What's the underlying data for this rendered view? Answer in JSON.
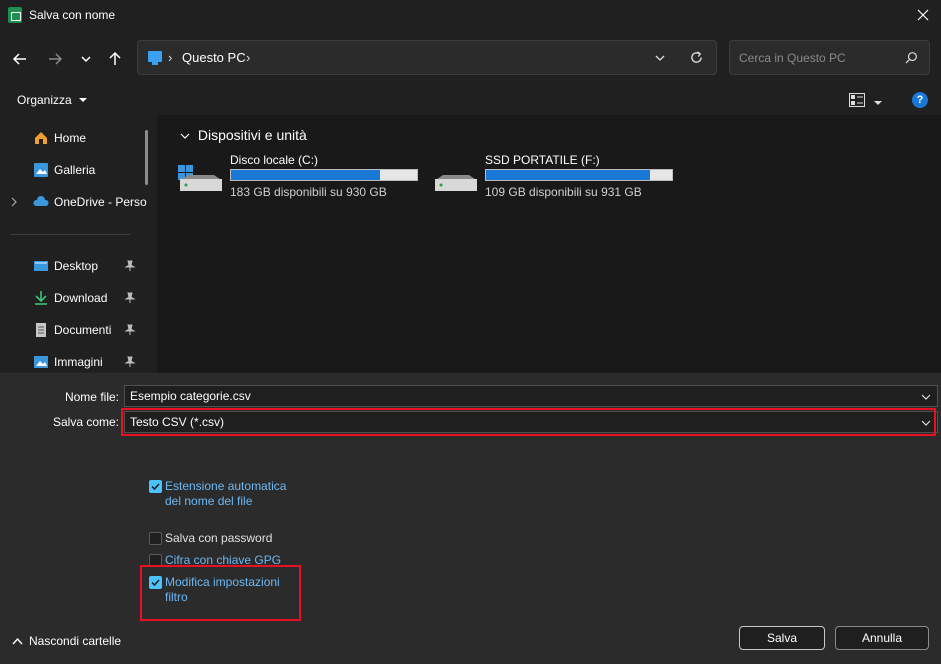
{
  "window": {
    "title": "Salva con nome",
    "close_icon": "close-icon"
  },
  "nav": {
    "back_icon": "arrow-left-icon",
    "forward_icon": "arrow-right-icon",
    "recent_icon": "chevron-down-icon",
    "up_icon": "arrow-up-icon",
    "address": {
      "location": "Questo PC",
      "icon": "pc-icon"
    },
    "search": {
      "placeholder": "Cerca in Questo PC",
      "icon": "search-icon"
    }
  },
  "toolbar": {
    "organize_label": "Organizza",
    "view_icon": "view-details-icon",
    "help_icon": "?"
  },
  "sidebar": {
    "items": [
      {
        "label": "Home",
        "icon": "home-icon"
      },
      {
        "label": "Galleria",
        "icon": "gallery-icon"
      },
      {
        "label": "OneDrive - Perso",
        "icon": "cloud-icon"
      },
      {
        "label": "Desktop",
        "icon": "desktop-icon",
        "pinned": true
      },
      {
        "label": "Download",
        "icon": "download-icon",
        "pinned": true
      },
      {
        "label": "Documenti",
        "icon": "documents-icon",
        "pinned": true
      },
      {
        "label": "Immagini",
        "icon": "pictures-icon",
        "pinned": true
      }
    ]
  },
  "main": {
    "group_title": "Dispositivi e unità",
    "drives": [
      {
        "name": "Disco locale (C:)",
        "info": "183 GB disponibili su 930 GB",
        "used_fraction": 0.803
      },
      {
        "name": "SSD PORTATILE (F:)",
        "info": "109 GB disponibili su 931 GB",
        "used_fraction": 0.883
      }
    ]
  },
  "form": {
    "filename_label": "Nome file:",
    "filename_value": "Esempio categorie.csv",
    "savetype_label": "Salva come:",
    "savetype_value": "Testo CSV (*.csv)"
  },
  "options": {
    "auto_ext": {
      "label_line1": "Estensione automatica",
      "label_line2": "del nome del file",
      "checked": true
    },
    "password": {
      "label": "Salva con password",
      "checked": false
    },
    "gpg": {
      "label": "Cifra con chiave GPG",
      "checked": false
    },
    "filter": {
      "label_line1": "Modifica impostazioni",
      "label_line2": "filtro",
      "checked": true
    }
  },
  "footer": {
    "hide_folders": "Nascondi cartelle",
    "save": "Salva",
    "cancel": "Annulla"
  },
  "colors": {
    "accent": "#1a78d6",
    "checkbox": "#4cc2ff",
    "highlight": "#e81123"
  }
}
